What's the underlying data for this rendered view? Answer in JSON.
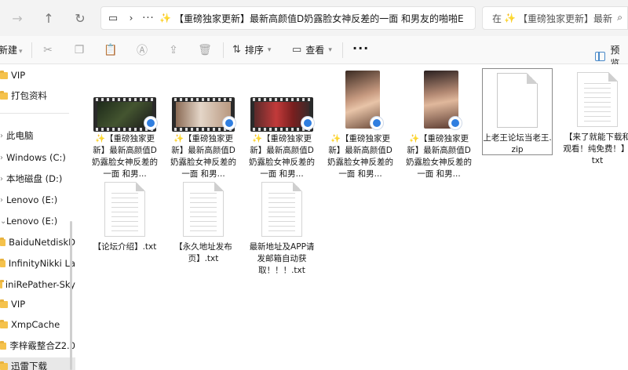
{
  "address": {
    "path": "【重磅独家更新】最新高颜值D奶露脸女神反差的一面 和男友的啪啪E"
  },
  "search": {
    "prefix": "在",
    "text": "【重磅独家更新】最新"
  },
  "toolbar": {
    "new_label": "新建",
    "sort_label": "排序",
    "view_label": "查看",
    "preview_label": "预览"
  },
  "sidebar": {
    "items": [
      {
        "label": "VIP"
      },
      {
        "label": "打包资料"
      },
      {
        "label": "此电脑"
      },
      {
        "label": "Windows (C:)"
      },
      {
        "label": "本地磁盘 (D:)"
      },
      {
        "label": "Lenovo (E:)"
      },
      {
        "label": "Lenovo (E:)"
      },
      {
        "label": "BaiduNetdiskD"
      },
      {
        "label": "InfinityNikki La"
      },
      {
        "label": "iniRePather-Sky"
      },
      {
        "label": "VIP"
      },
      {
        "label": "XmpCache"
      },
      {
        "label": "李梓霰整合Z2.0"
      },
      {
        "label": "迅雷下载"
      }
    ]
  },
  "files": [
    {
      "label": "✨【重磅独家更新】最新高颜值D奶露脸女神反差的一面 和男..."
    },
    {
      "label": "✨【重磅独家更新】最新高颜值D奶露脸女神反差的一面 和男..."
    },
    {
      "label": "✨【重磅独家更新】最新高颜值D奶露脸女神反差的一面 和男..."
    },
    {
      "label": "✨【重磅独家更新】最新高颜值D奶露脸女神反差的一面 和男..."
    },
    {
      "label": "✨【重磅独家更新】最新高颜值D奶露脸女神反差的一面 和男..."
    },
    {
      "label": "上老王论坛当老王.zip"
    },
    {
      "label": "【来了就能下载和观看！纯免费！】.txt"
    },
    {
      "label": "【论坛介绍】.txt"
    },
    {
      "label": "【永久地址发布页】.txt"
    },
    {
      "label": "最新地址及APP请发邮箱自动获取！！！.txt"
    }
  ],
  "colors": {
    "folder": "#f5c24c",
    "accent": "#2f7ee0",
    "sparkle": "#e7a53a"
  }
}
